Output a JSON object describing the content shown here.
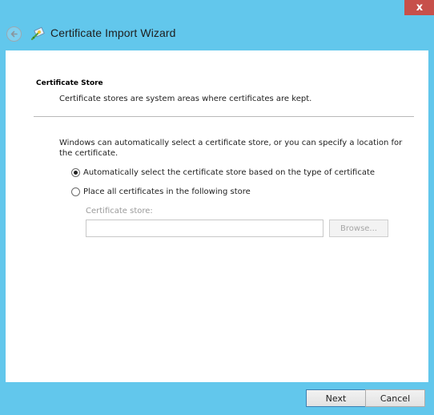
{
  "window": {
    "close_glyph": "x",
    "title": "Certificate Import Wizard"
  },
  "section": {
    "header": "Certificate Store",
    "description": "Certificate stores are system areas where certificates are kept."
  },
  "intro": "Windows can automatically select a certificate store, or you can specify a location for the certificate.",
  "options": [
    {
      "label": "Automatically select the certificate store based on the type of certificate",
      "selected": true
    },
    {
      "label": "Place all certificates in the following store",
      "selected": false
    }
  ],
  "store": {
    "label": "Certificate store:",
    "value": "",
    "browse_label": "Browse..."
  },
  "footer": {
    "next_label": "Next",
    "cancel_label": "Cancel"
  },
  "colors": {
    "window_frame": "#62c7ec",
    "close_button": "#c7504a",
    "default_button_border": "#3c7fb1"
  },
  "icons": {
    "back": "back-arrow-icon",
    "wizard": "certificate-wizard-icon"
  }
}
